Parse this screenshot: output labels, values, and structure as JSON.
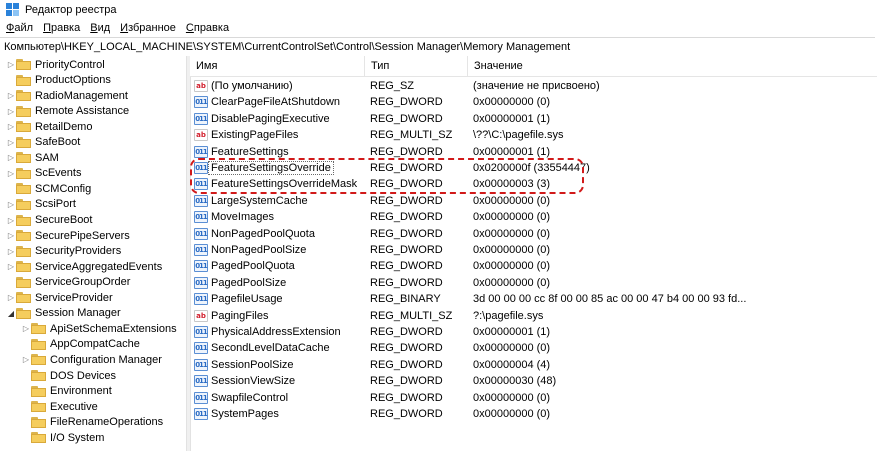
{
  "window": {
    "title": "Редактор реестра",
    "icon": "regedit-icon"
  },
  "menu": [
    {
      "accel": "Ф",
      "rest": "айл"
    },
    {
      "accel": "П",
      "rest": "равка"
    },
    {
      "accel": "В",
      "rest": "ид"
    },
    {
      "accel": "И",
      "rest": "збранное"
    },
    {
      "accel": "С",
      "rest": "правка"
    }
  ],
  "address": "Компьютер\\HKEY_LOCAL_MACHINE\\SYSTEM\\CurrentControlSet\\Control\\Session Manager\\Memory Management",
  "tree": [
    {
      "label": "PriorityControl",
      "level": 0,
      "expander": "collapsed"
    },
    {
      "label": "ProductOptions",
      "level": 0,
      "expander": "none"
    },
    {
      "label": "RadioManagement",
      "level": 0,
      "expander": "collapsed"
    },
    {
      "label": "Remote Assistance",
      "level": 0,
      "expander": "collapsed"
    },
    {
      "label": "RetailDemo",
      "level": 0,
      "expander": "collapsed"
    },
    {
      "label": "SafeBoot",
      "level": 0,
      "expander": "collapsed"
    },
    {
      "label": "SAM",
      "level": 0,
      "expander": "collapsed"
    },
    {
      "label": "ScEvents",
      "level": 0,
      "expander": "collapsed"
    },
    {
      "label": "SCMConfig",
      "level": 0,
      "expander": "none"
    },
    {
      "label": "ScsiPort",
      "level": 0,
      "expander": "collapsed"
    },
    {
      "label": "SecureBoot",
      "level": 0,
      "expander": "collapsed"
    },
    {
      "label": "SecurePipeServers",
      "level": 0,
      "expander": "collapsed"
    },
    {
      "label": "SecurityProviders",
      "level": 0,
      "expander": "collapsed"
    },
    {
      "label": "ServiceAggregatedEvents",
      "level": 0,
      "expander": "collapsed"
    },
    {
      "label": "ServiceGroupOrder",
      "level": 0,
      "expander": "none"
    },
    {
      "label": "ServiceProvider",
      "level": 0,
      "expander": "collapsed"
    },
    {
      "label": "Session Manager",
      "level": 0,
      "expander": "expanded"
    },
    {
      "label": "ApiSetSchemaExtensions",
      "level": 1,
      "expander": "collapsed"
    },
    {
      "label": "AppCompatCache",
      "level": 1,
      "expander": "none"
    },
    {
      "label": "Configuration Manager",
      "level": 1,
      "expander": "collapsed"
    },
    {
      "label": "DOS Devices",
      "level": 1,
      "expander": "none"
    },
    {
      "label": "Environment",
      "level": 1,
      "expander": "none"
    },
    {
      "label": "Executive",
      "level": 1,
      "expander": "none"
    },
    {
      "label": "FileRenameOperations",
      "level": 1,
      "expander": "none"
    },
    {
      "label": "I/O System",
      "level": 1,
      "expander": "none"
    }
  ],
  "columns": {
    "name": "Имя",
    "type": "Тип",
    "data": "Значение"
  },
  "values": [
    {
      "name": "(По умолчанию)",
      "type": "REG_SZ",
      "data": "(значение не присвоено)",
      "icon": "string-value-icon",
      "kind": "sz"
    },
    {
      "name": "ClearPageFileAtShutdown",
      "type": "REG_DWORD",
      "data": "0x00000000 (0)",
      "icon": "binary-value-icon",
      "kind": "bin"
    },
    {
      "name": "DisablePagingExecutive",
      "type": "REG_DWORD",
      "data": "0x00000001 (1)",
      "icon": "binary-value-icon",
      "kind": "bin"
    },
    {
      "name": "ExistingPageFiles",
      "type": "REG_MULTI_SZ",
      "data": "\\??\\C:\\pagefile.sys",
      "icon": "string-value-icon",
      "kind": "sz"
    },
    {
      "name": "FeatureSettings",
      "type": "REG_DWORD",
      "data": "0x00000001 (1)",
      "icon": "binary-value-icon",
      "kind": "bin"
    },
    {
      "name": "FeatureSettingsOverride",
      "type": "REG_DWORD",
      "data": "0x0200000f (33554447)",
      "icon": "binary-value-icon",
      "kind": "bin",
      "focused": true
    },
    {
      "name": "FeatureSettingsOverrideMask",
      "type": "REG_DWORD",
      "data": "0x00000003 (3)",
      "icon": "binary-value-icon",
      "kind": "bin"
    },
    {
      "name": "LargeSystemCache",
      "type": "REG_DWORD",
      "data": "0x00000000 (0)",
      "icon": "binary-value-icon",
      "kind": "bin"
    },
    {
      "name": "MoveImages",
      "type": "REG_DWORD",
      "data": "0x00000000 (0)",
      "icon": "binary-value-icon",
      "kind": "bin"
    },
    {
      "name": "NonPagedPoolQuota",
      "type": "REG_DWORD",
      "data": "0x00000000 (0)",
      "icon": "binary-value-icon",
      "kind": "bin"
    },
    {
      "name": "NonPagedPoolSize",
      "type": "REG_DWORD",
      "data": "0x00000000 (0)",
      "icon": "binary-value-icon",
      "kind": "bin"
    },
    {
      "name": "PagedPoolQuota",
      "type": "REG_DWORD",
      "data": "0x00000000 (0)",
      "icon": "binary-value-icon",
      "kind": "bin"
    },
    {
      "name": "PagedPoolSize",
      "type": "REG_DWORD",
      "data": "0x00000000 (0)",
      "icon": "binary-value-icon",
      "kind": "bin"
    },
    {
      "name": "PagefileUsage",
      "type": "REG_BINARY",
      "data": "3d 00 00 00 cc 8f 00 00 85 ac 00 00 47 b4 00 00 93 fd...",
      "icon": "binary-value-icon",
      "kind": "bin"
    },
    {
      "name": "PagingFiles",
      "type": "REG_MULTI_SZ",
      "data": "?:\\pagefile.sys",
      "icon": "string-value-icon",
      "kind": "sz"
    },
    {
      "name": "PhysicalAddressExtension",
      "type": "REG_DWORD",
      "data": "0x00000001 (1)",
      "icon": "binary-value-icon",
      "kind": "bin"
    },
    {
      "name": "SecondLevelDataCache",
      "type": "REG_DWORD",
      "data": "0x00000000 (0)",
      "icon": "binary-value-icon",
      "kind": "bin"
    },
    {
      "name": "SessionPoolSize",
      "type": "REG_DWORD",
      "data": "0x00000004 (4)",
      "icon": "binary-value-icon",
      "kind": "bin"
    },
    {
      "name": "SessionViewSize",
      "type": "REG_DWORD",
      "data": "0x00000030 (48)",
      "icon": "binary-value-icon",
      "kind": "bin"
    },
    {
      "name": "SwapfileControl",
      "type": "REG_DWORD",
      "data": "0x00000000 (0)",
      "icon": "binary-value-icon",
      "kind": "bin"
    },
    {
      "name": "SystemPages",
      "type": "REG_DWORD",
      "data": "0x00000000 (0)",
      "icon": "binary-value-icon",
      "kind": "bin"
    }
  ],
  "colors": {
    "annotation": "#d11a1a",
    "folder": "#f5cd5d",
    "string_icon": "#d2202e",
    "binary_icon": "#2a6bc4"
  }
}
